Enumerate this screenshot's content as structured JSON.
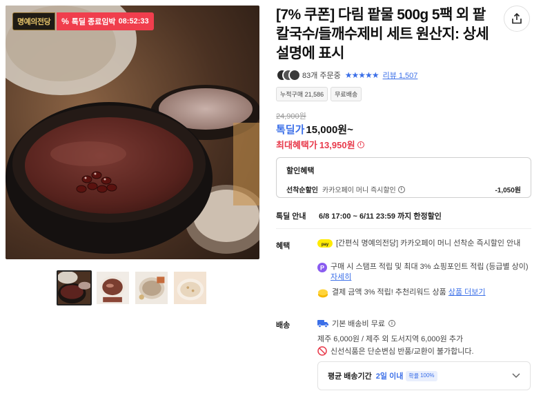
{
  "gallery": {
    "badge_brand": "명예의전당",
    "badge_timer_prefix": "톡딜 종료임박",
    "badge_timer_time": "08:52:33",
    "thumbnail_count": 4,
    "active_thumbnail": 1
  },
  "product": {
    "title": "[7% 쿠폰] 다림 팥물 500g 5팩 외 팥칼국수/들깨수제비 세트 원산지: 상세설명에 표시",
    "order_count": "83개 주문중",
    "stars": "★★★★★",
    "review_link": "리뷰 1,507",
    "chips": [
      "누적구매 21,586",
      "무료배송"
    ],
    "original_price": "24,900원",
    "deal_label": "톡딜가",
    "deal_price": "15,000원~",
    "max_benefit_label": "최대혜택가",
    "max_benefit_price": "13,950원"
  },
  "discount": {
    "title": "할인혜택",
    "line_label": "선착순할인",
    "line_desc": "카카오페이 머니 즉시할인",
    "line_amount": "-1,050원"
  },
  "period": {
    "label": "톡딜 안내",
    "value": "6/8 17:00 ~ 6/11 23:59 까지 한정할인"
  },
  "benefits": {
    "label": "혜택",
    "items": [
      {
        "text": "[간편식 명예의전당] 카카오페이 머니 선착순 즉시할인 안내",
        "icon": "kakaopay-icon"
      },
      {
        "text": "구매 시 스탬프 적립 및 최대 3% 쇼핑포인트 적립 (등급별 상이)",
        "link": "자세히",
        "icon": "point-icon"
      },
      {
        "text": "결제 금액 3% 적립! 추천리워드 상품",
        "link": "상품 더보기",
        "icon": "reward-icon"
      }
    ]
  },
  "shipping": {
    "label": "배송",
    "fee": "기본 배송비 무료",
    "extra": "제주 6,000원 / 제주 외 도서지역 6,000원 추가",
    "notice": "신선식품은 단순변심 반품/교환이 불가합니다.",
    "avg_label": "평균 배송기간",
    "avg_value": "2일 이내",
    "rate_label": "확률",
    "rate_value": "100%"
  },
  "colors": {
    "accent_blue": "#3b6fe8",
    "accent_red": "#e8394a",
    "timer_red": "#f03e4d"
  }
}
